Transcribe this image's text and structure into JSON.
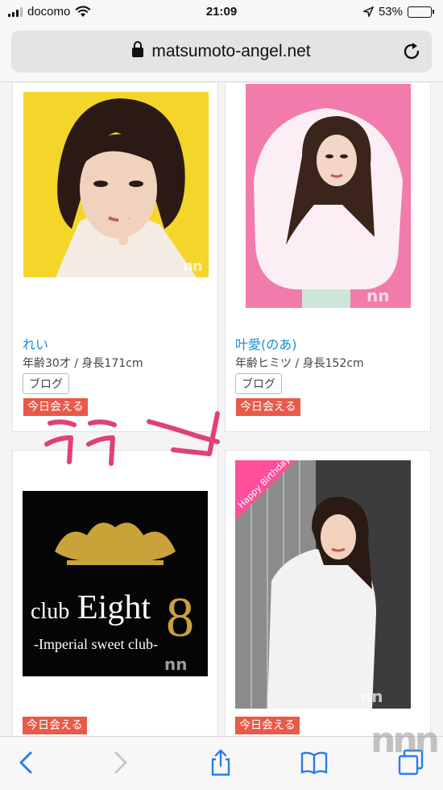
{
  "status_bar": {
    "carrier": "docomo",
    "time": "21:09",
    "battery_percent": "53%",
    "battery_level": 0.53
  },
  "browser": {
    "url": "matsumoto-angel.net"
  },
  "cards": [
    {
      "badge": "今日会える",
      "name": "れい",
      "meta": "年齢30才 / 身長171cm",
      "blog": "ブログ"
    },
    {
      "badge": "今日会える",
      "name": "叶愛(のあ)",
      "meta": "年齢ヒミツ / 身長152cm",
      "blog": "ブログ"
    },
    {
      "badge": "今日会える",
      "logo_line1": "club",
      "logo_line2": "Eight",
      "logo_line3": "-Imperial sweet club-"
    },
    {
      "badge": "今日会える",
      "ribbon": "Happy Birthday"
    }
  ],
  "annotation": {
    "text": "ココ"
  },
  "watermark": {
    "small": "nn",
    "large": "nnn"
  },
  "colors": {
    "badge": "#e85a4a",
    "name_link": "#1a8ed6",
    "annotation": "#e0407a",
    "ribbon": "#ff4f9a"
  }
}
